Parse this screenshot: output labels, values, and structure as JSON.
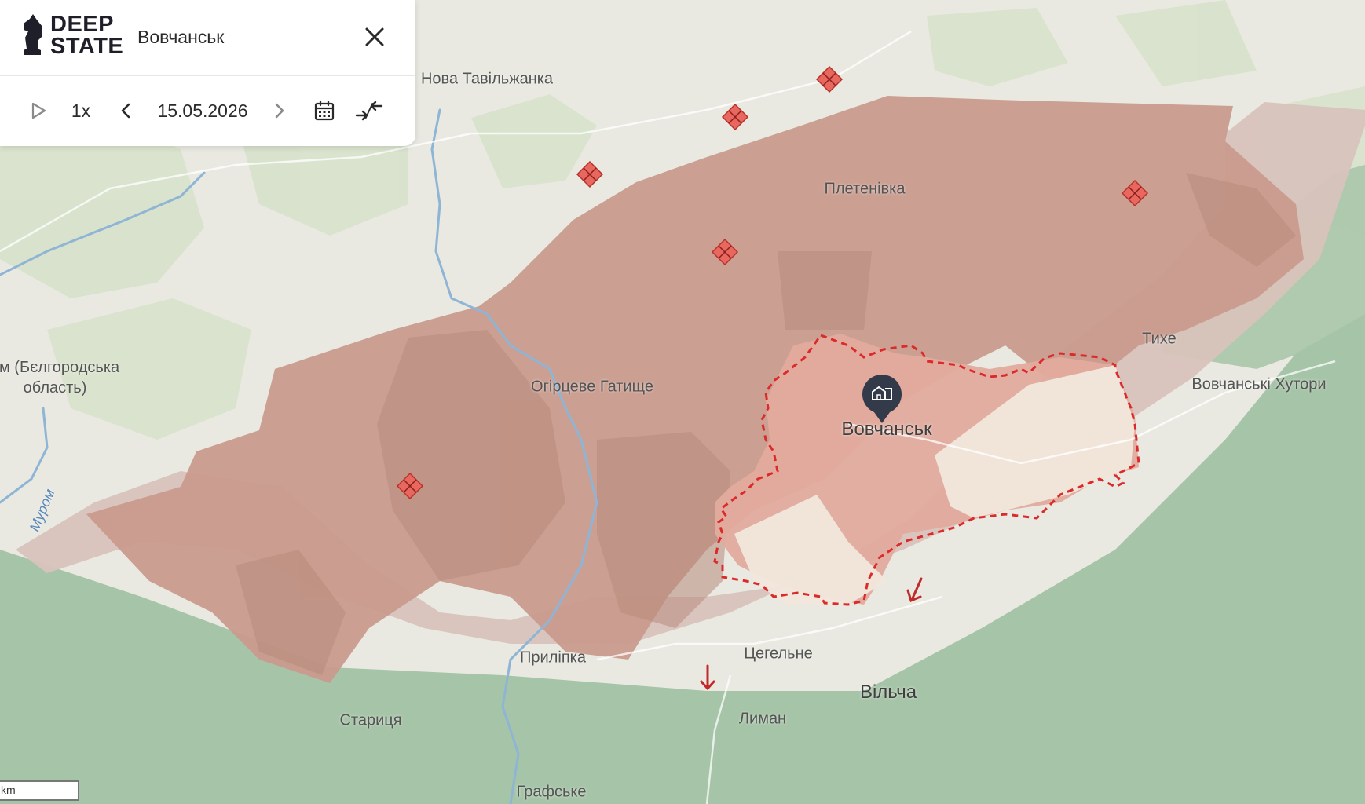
{
  "app": {
    "logo_line1": "DEEP",
    "logo_line2": "STATE"
  },
  "search": {
    "query": "Вовчанськ"
  },
  "playback": {
    "speed": "1x",
    "date": "15.05.2026"
  },
  "icons": {
    "logo": "chess-knight-icon",
    "close": "close-icon",
    "play": "play-icon",
    "prev": "chevron-left-icon",
    "next": "chevron-right-icon",
    "calendar": "calendar-icon",
    "collapse": "collapse-arrows-icon",
    "city_marker": "city-building-icon",
    "attack": "red-arrow-icon"
  },
  "map": {
    "labels": {
      "nova_tavilzhanka": "Нова Тавільжанка",
      "pletenivka": "Плетенівка",
      "tykhe": "Тихе",
      "ohirtseve_hatyshche": "Огірцеве Гатище",
      "vovchansk": "Вовчанськ",
      "vovchanski_khutory": "Вовчанські Хутори",
      "belgorod_line1": "ом (Бєлгородська",
      "belgorod_line2": "область)",
      "murom_river": "Муром",
      "prylipka": "Приліпка",
      "tsehelne": "Цегельне",
      "vilcha": "Вільча",
      "starytsia": "Стариця",
      "lyman": "Лиман",
      "hrafske": "Графське"
    },
    "scale_unit": "km",
    "colors": {
      "background": "#e9e9e1",
      "forest": "#cfdbc1",
      "green_zone": "#a3c3a3",
      "occupied": "#c89a8c",
      "gray_zone": "#d6c0ba",
      "contested": "#e0ac9e",
      "liberated": "#f1e4da",
      "border_dash": "#dc2a2a",
      "marker": "#e8675f",
      "river": "#8eb5d6"
    }
  }
}
